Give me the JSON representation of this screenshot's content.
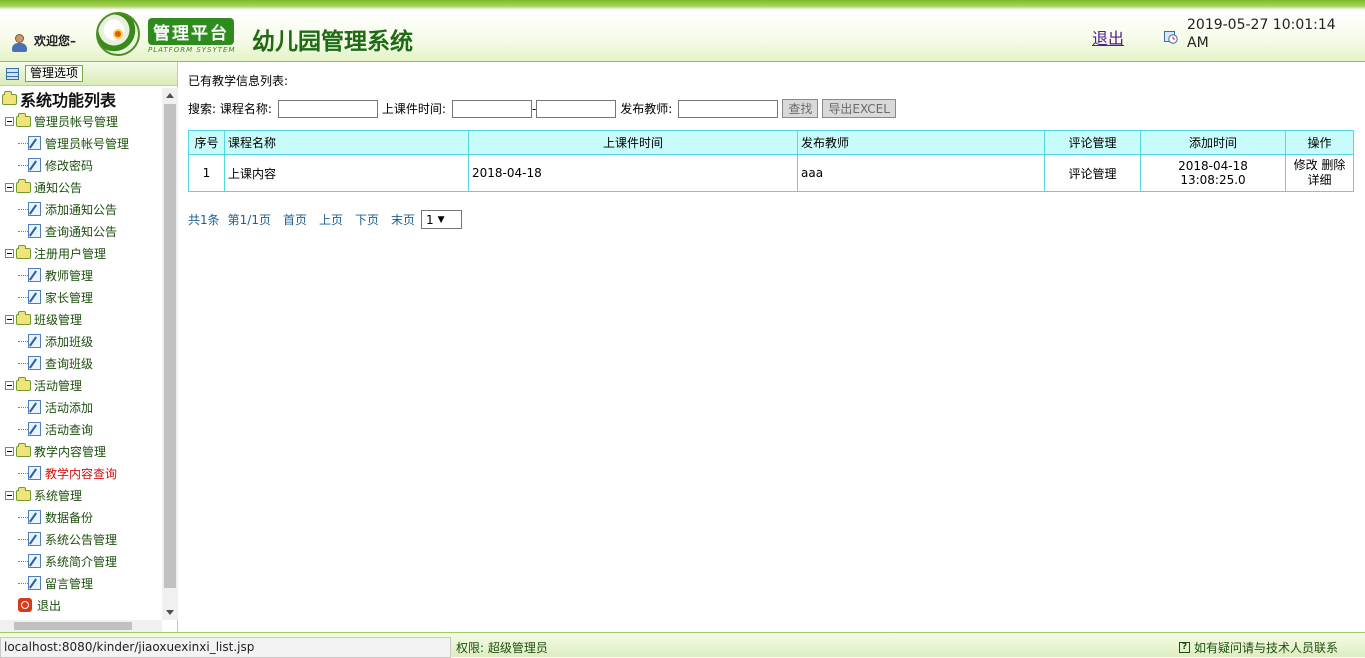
{
  "header": {
    "welcome": "欢迎您–",
    "brand_cn": "管理平台",
    "brand_en": "PLATFORM SYSYTEM",
    "app_title": "幼儿园管理系统",
    "logout": "退出",
    "datetime": "2019-05-27 10:01:14 AM"
  },
  "sidebar": {
    "header_button": "管理选项",
    "root": "系统功能列表",
    "groups": [
      {
        "label": "管理员帐号管理",
        "items": [
          "管理员帐号管理",
          "修改密码"
        ]
      },
      {
        "label": "通知公告",
        "items": [
          "添加通知公告",
          "查询通知公告"
        ]
      },
      {
        "label": "注册用户管理",
        "items": [
          "教师管理",
          "家长管理"
        ]
      },
      {
        "label": "班级管理",
        "items": [
          "添加班级",
          "查询班级"
        ]
      },
      {
        "label": "活动管理",
        "items": [
          "活动添加",
          "活动查询"
        ]
      },
      {
        "label": "教学内容管理",
        "items": [
          "教学内容查询"
        ]
      },
      {
        "label": "系统管理",
        "items": [
          "数据备份",
          "系统公告管理",
          "系统简介管理",
          "留言管理"
        ]
      }
    ],
    "exit": "退出"
  },
  "main": {
    "section_title": "已有教学信息列表:",
    "search": {
      "label": "搜索: 课程名称:",
      "time_label": "上课件时间:",
      "dash": "-",
      "teacher_label": "发布教师:",
      "find_button": "查找",
      "export_button": "导出EXCEL"
    },
    "table": {
      "headers": [
        "序号",
        "课程名称",
        "上课件时间",
        "发布教师",
        "评论管理",
        "添加时间",
        "操作"
      ],
      "rows": [
        {
          "no": "1",
          "course": "上课内容",
          "time": "2018-04-18",
          "teacher": "aaa",
          "comment": "评论管理",
          "added": "2018-04-18 13:08:25.0",
          "op_edit": "修改",
          "op_delete": "删除",
          "op_detail": "详细"
        }
      ]
    },
    "pager": {
      "total": "共1条",
      "page": "第1/1页",
      "first": "首页",
      "prev": "上页",
      "next": "下页",
      "last": "末页",
      "select": "1"
    }
  },
  "footer": {
    "status_url": "localhost:8080/kinder/jiaoxuexinxi_list.jsp",
    "permission": "权限:  超级管理员",
    "help": "如有疑问请与技术人员联系"
  }
}
